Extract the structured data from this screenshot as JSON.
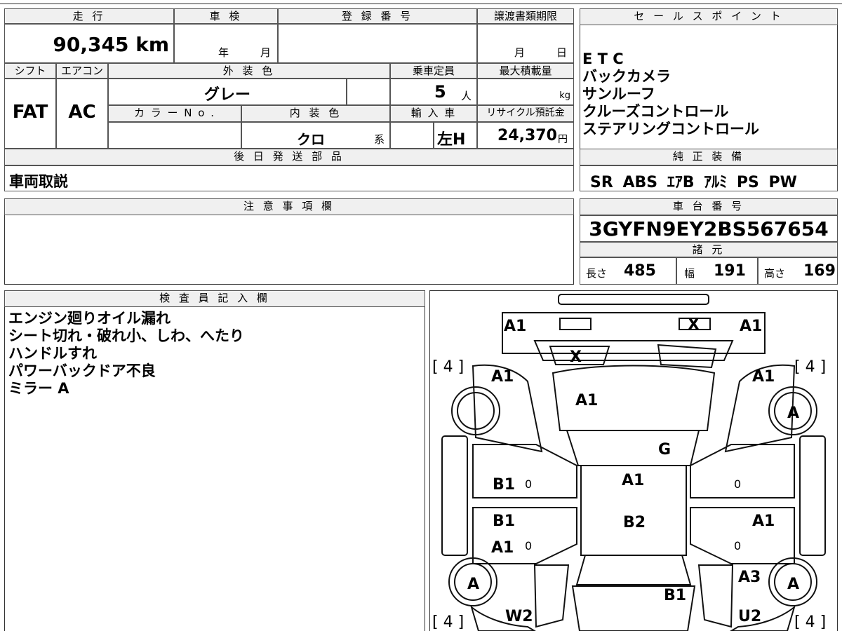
{
  "header": {
    "mileage_label": "走 行",
    "shaken_label": "車 検",
    "reg_label": "登 録 番 号",
    "transfer_label": "譲渡書類期限",
    "sales_label": "セ ー ル ス ポ イ ン ト"
  },
  "values": {
    "mileage": "90,345 km",
    "shaken_year": "年",
    "shaken_month": "月",
    "transfer_month": "月",
    "transfer_day": "日"
  },
  "row2": {
    "shift_label": "シフト",
    "ac_label": "エアコン",
    "color_label": "外 装 色",
    "capacity_label": "乗車定員",
    "maxload_label": "最大積載量",
    "shift": "FAT",
    "ac": "AC",
    "color": "グレー",
    "capacity": "5",
    "capacity_unit": "人",
    "maxload_unit": "kg",
    "colorno_label": "カ ラ ー N o .",
    "interior_label": "内 装 色",
    "import_label": "輸 入 車",
    "recycle_label": "リサイクル預託金",
    "interior": "クロ",
    "interior_unit": "系",
    "import": "左H",
    "recycle": "24,370",
    "recycle_unit": "円"
  },
  "sales_points": [
    "E T C",
    "バックカメラ",
    "サンルーフ",
    "クルーズコントロール",
    "ステアリングコントロール"
  ],
  "genuine": {
    "label": "純 正 装 備",
    "items": "SR ABS ｴｱB ｱﾙﾐ PS PW"
  },
  "later_parts": {
    "label": "後 日 発 送 部 品",
    "value": "車両取説"
  },
  "notes": {
    "label": "注 意 事 項 欄"
  },
  "chassis": {
    "label": "車 台 番 号",
    "value": "3GYFN9EY2BS567654",
    "spec_label": "諸 元",
    "length_label": "長さ",
    "length": "485",
    "width_label": "幅",
    "width": "191",
    "height_label": "高さ",
    "height": "169"
  },
  "inspector": {
    "label": "検 査 員 記 入 欄",
    "lines": [
      "エンジン廻りオイル漏れ",
      "シート切れ・破れ小、しわ、へたり",
      "ハンドルすれ",
      "パワーバックドア不良",
      "ミラー A"
    ]
  },
  "diagram": {
    "front_left": "A1",
    "front_x": "X",
    "front_right": "A1",
    "windshield_x": "X",
    "tire_fl": "[ 4 ]",
    "tire_fr": "[ 4 ]",
    "tire_rl": "[ 4 ]",
    "tire_rr": "[ 4 ]",
    "fender_l": "A1",
    "fender_r": "A1",
    "hood": "A1",
    "wheel_fr": "A",
    "windshield_g": "G",
    "roof": "A1",
    "door_fl": "B1",
    "door_fl_zero": "0",
    "door_fr_zero": "0",
    "door_rl": "B1",
    "door_rl2": "A1",
    "door_rl_zero": "0",
    "door_rr": "A1",
    "door_rr_zero": "0",
    "roof_rear": "B2",
    "wheel_rl": "A",
    "wheel_rr": "A",
    "quarter_r": "A3",
    "tailgate": "B1",
    "rear_l": "W2",
    "rear_r": "U2"
  }
}
